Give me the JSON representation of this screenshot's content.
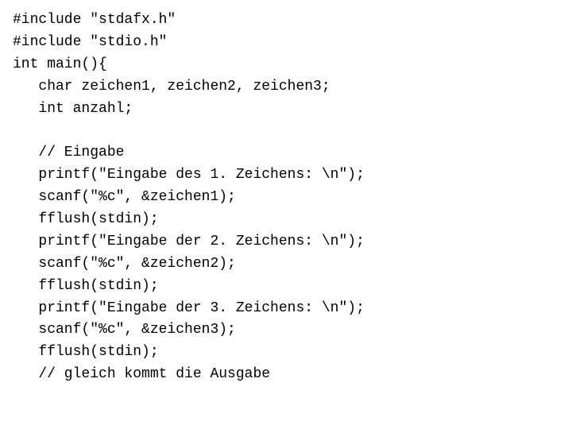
{
  "code": {
    "lines": [
      "#include \"stdafx.h\"",
      "#include \"stdio.h\"",
      "int main(){",
      "   char zeichen1, zeichen2, zeichen3;",
      "   int anzahl;",
      "",
      "   // Eingabe",
      "   printf(\"Eingabe des 1. Zeichens: \\n\");",
      "   scanf(\"%c\", &zeichen1);",
      "   fflush(stdin);",
      "   printf(\"Eingabe der 2. Zeichens: \\n\");",
      "   scanf(\"%c\", &zeichen2);",
      "   fflush(stdin);",
      "   printf(\"Eingabe der 3. Zeichens: \\n\");",
      "   scanf(\"%c\", &zeichen3);",
      "   fflush(stdin);",
      "   // gleich kommt die Ausgabe"
    ]
  }
}
